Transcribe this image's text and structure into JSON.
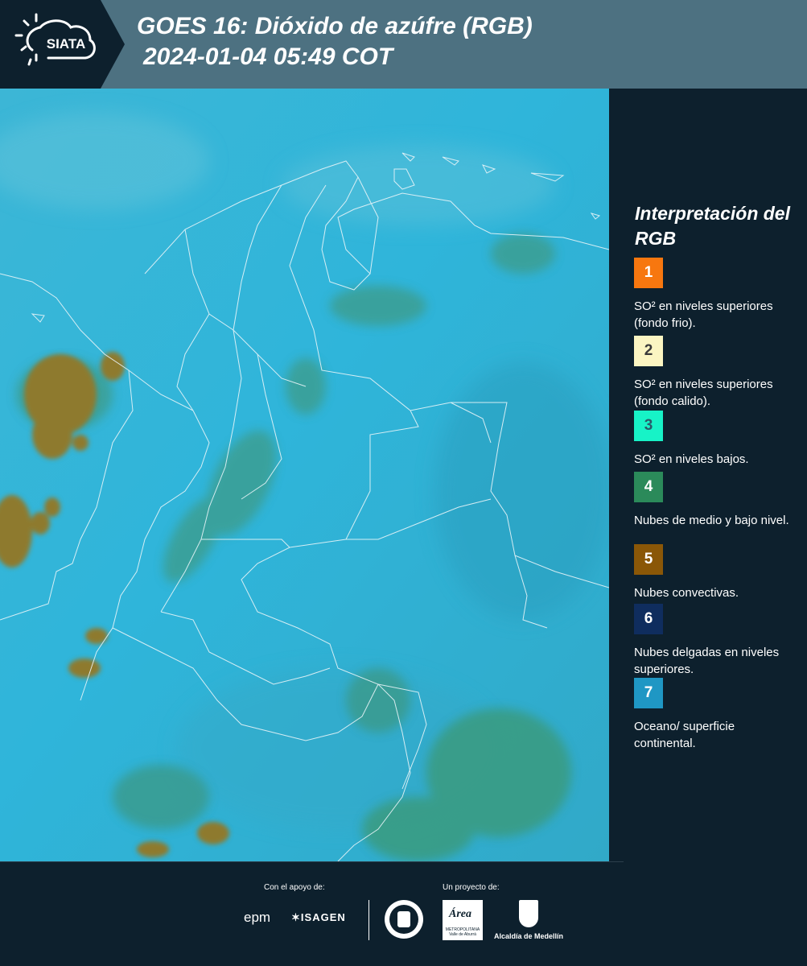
{
  "header": {
    "logo_text": "SIATA",
    "title_line1": "GOES 16: Dióxido de azúfre (RGB)",
    "title_line2": "2024-01-04 05:49 COT"
  },
  "legend": {
    "title": "Interpretación del RGB",
    "items": [
      {
        "num": "1",
        "color": "#f7770f",
        "text": "SO² en niveles superiores (fondo frio)."
      },
      {
        "num": "2",
        "color": "#fbf5c2",
        "text": "SO² en niveles superiores (fondo calido)."
      },
      {
        "num": "3",
        "color": "#17f3c7",
        "text": "SO² en niveles bajos."
      },
      {
        "num": "4",
        "color": "#2b8a5a",
        "text": "Nubes de medio y bajo nivel."
      },
      {
        "num": "5",
        "color": "#8a5707",
        "text": "Nubes convectivas."
      },
      {
        "num": "6",
        "color": "#0f2d5e",
        "text": "Nubes delgadas en niveles superiores."
      },
      {
        "num": "7",
        "color": "#1f97c4",
        "text": "Oceano/ superficie continental."
      }
    ]
  },
  "footer": {
    "support_label": "Con el apoyo de:",
    "project_label": "Un proyecto de:",
    "sponsor_epm": "epm",
    "sponsor_isagen": "ISAGEN",
    "sponsor_area": "Área",
    "sponsor_area_sub": "METROPOLITANA Valle de Aburrá",
    "sponsor_medellin": "Alcaldía de Medellín"
  }
}
